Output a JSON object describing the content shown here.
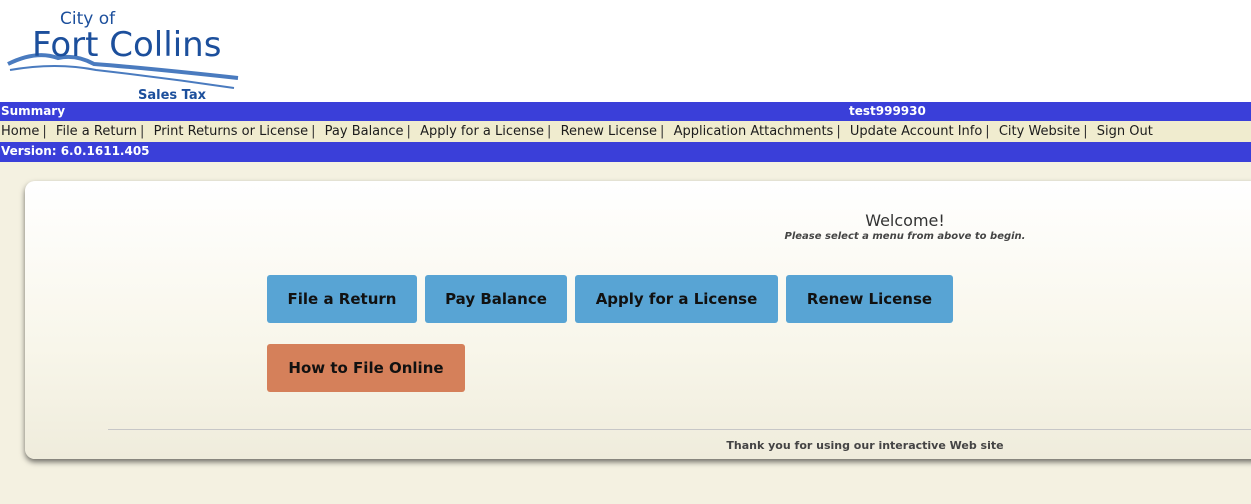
{
  "logo": {
    "city_of": "City of",
    "name": "Fort Collins",
    "subtitle": "Sales Tax"
  },
  "summary_bar": {
    "label": "Summary",
    "user": "test999930"
  },
  "nav": {
    "items": [
      {
        "label": "Home"
      },
      {
        "label": "File a Return"
      },
      {
        "label": "Print Returns or License"
      },
      {
        "label": "Pay Balance"
      },
      {
        "label": "Apply for a License"
      },
      {
        "label": "Renew License"
      },
      {
        "label": "Application Attachments"
      },
      {
        "label": "Update Account Info"
      },
      {
        "label": "City Website"
      },
      {
        "label": "Sign Out"
      }
    ],
    "separator": "|"
  },
  "version_bar": {
    "label": "Version: 6.0.1611.405"
  },
  "welcome": {
    "title": "Welcome!",
    "subtitle": "Please select a menu from above to begin."
  },
  "buttons": {
    "file_return": "File a Return",
    "pay_balance": "Pay Balance",
    "apply_license": "Apply for a License",
    "renew_license": "Renew License",
    "how_to_file": "How to File Online"
  },
  "footer": {
    "text": "Thank you for using our interactive Web site"
  },
  "colors": {
    "bar_blue": "#3a3fd9",
    "nav_bg": "#f0eccf",
    "button_blue": "#58a4d4",
    "button_orange": "#d5805a",
    "logo_blue": "#1c4f9c"
  }
}
